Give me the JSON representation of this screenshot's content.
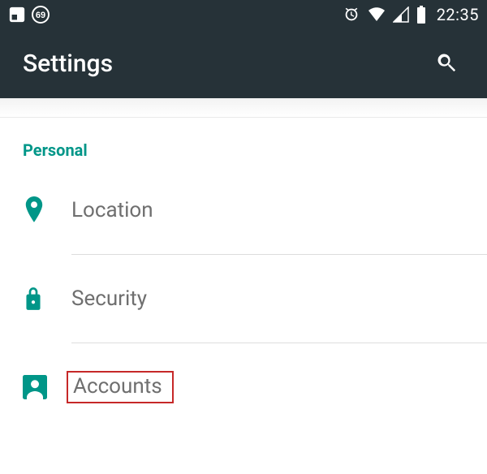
{
  "statusbar": {
    "badge_value": "69",
    "clock": "22:35"
  },
  "appbar": {
    "title": "Settings"
  },
  "section": {
    "header": "Personal",
    "items": [
      {
        "icon": "location",
        "label": "Location"
      },
      {
        "icon": "security",
        "label": "Security"
      },
      {
        "icon": "accounts",
        "label": "Accounts"
      }
    ]
  },
  "colors": {
    "accent": "#009688",
    "bar": "#263238",
    "text_secondary": "#6f6f6f",
    "highlight_border": "#c62828"
  }
}
